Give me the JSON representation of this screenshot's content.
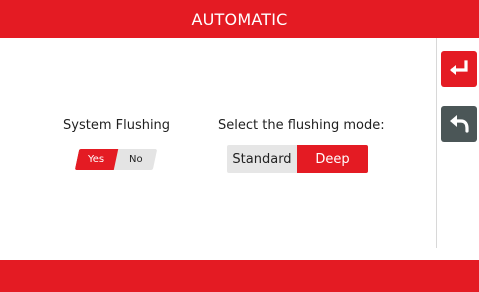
{
  "header": {
    "title": "AUTOMATIC"
  },
  "colors": {
    "accent": "#e41b23",
    "back_button": "#4b5657"
  },
  "side": {
    "enter_icon": "enter-icon",
    "back_icon": "back-arrow-icon"
  },
  "flushing": {
    "label": "System Flushing",
    "yes": "Yes",
    "no": "No",
    "selected": "Yes"
  },
  "mode": {
    "label": "Select the flushing mode:",
    "standard": "Standard",
    "deep": "Deep",
    "selected": "Deep"
  }
}
